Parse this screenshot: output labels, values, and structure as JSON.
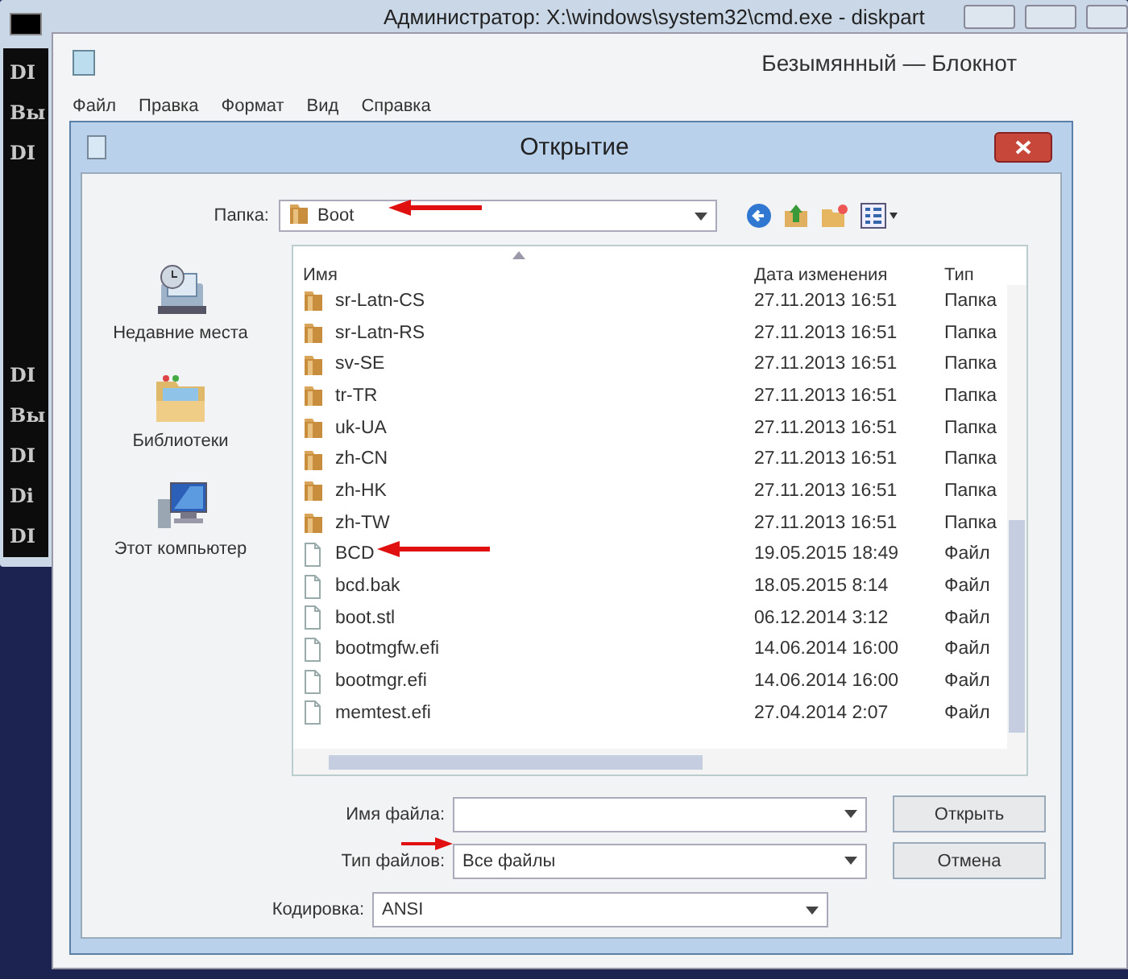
{
  "console": {
    "title": "Администратор: X:\\windows\\system32\\cmd.exe - diskpart",
    "lines_top": [
      "DI",
      "Вы",
      "DI"
    ],
    "lines_bottom": [
      "DI",
      "Вы",
      "DI",
      "Di",
      "DI"
    ]
  },
  "notepad": {
    "title": "Безымянный — Блокнот",
    "menu": [
      "Файл",
      "Правка",
      "Формат",
      "Вид",
      "Справка"
    ]
  },
  "dialog": {
    "title": "Открытие",
    "folder_label": "Папка:",
    "folder": "Boot",
    "places": [
      {
        "label": "Недавние места",
        "kind": "recent"
      },
      {
        "label": "Библиотеки",
        "kind": "libraries"
      },
      {
        "label": "Этот компьютер",
        "kind": "computer"
      }
    ],
    "columns": [
      "Имя",
      "Дата изменения",
      "Тип"
    ],
    "files": [
      {
        "name": "sr-Latn-CS",
        "date": "27.11.2013 16:51",
        "type": "Папка",
        "kind": "folder"
      },
      {
        "name": "sr-Latn-RS",
        "date": "27.11.2013 16:51",
        "type": "Папка",
        "kind": "folder"
      },
      {
        "name": "sv-SE",
        "date": "27.11.2013 16:51",
        "type": "Папка",
        "kind": "folder"
      },
      {
        "name": "tr-TR",
        "date": "27.11.2013 16:51",
        "type": "Папка",
        "kind": "folder"
      },
      {
        "name": "uk-UA",
        "date": "27.11.2013 16:51",
        "type": "Папка",
        "kind": "folder"
      },
      {
        "name": "zh-CN",
        "date": "27.11.2013 16:51",
        "type": "Папка",
        "kind": "folder"
      },
      {
        "name": "zh-HK",
        "date": "27.11.2013 16:51",
        "type": "Папка",
        "kind": "folder"
      },
      {
        "name": "zh-TW",
        "date": "27.11.2013 16:51",
        "type": "Папка",
        "kind": "folder"
      },
      {
        "name": "BCD",
        "date": "19.05.2015 18:49",
        "type": "Файл",
        "kind": "file"
      },
      {
        "name": "bcd.bak",
        "date": "18.05.2015 8:14",
        "type": "Файл",
        "kind": "file"
      },
      {
        "name": "boot.stl",
        "date": "06.12.2014 3:12",
        "type": "Файл",
        "kind": "file"
      },
      {
        "name": "bootmgfw.efi",
        "date": "14.06.2014 16:00",
        "type": "Файл",
        "kind": "file"
      },
      {
        "name": "bootmgr.efi",
        "date": "14.06.2014 16:00",
        "type": "Файл",
        "kind": "file"
      },
      {
        "name": "memtest.efi",
        "date": "27.04.2014 2:07",
        "type": "Файл",
        "kind": "file"
      }
    ],
    "filename_label": "Имя файла:",
    "filetype_label": "Тип файлов:",
    "filetype": "Все файлы",
    "encoding_label": "Кодировка:",
    "encoding": "ANSI",
    "buttons": [
      "Открыть",
      "Отмена"
    ]
  }
}
